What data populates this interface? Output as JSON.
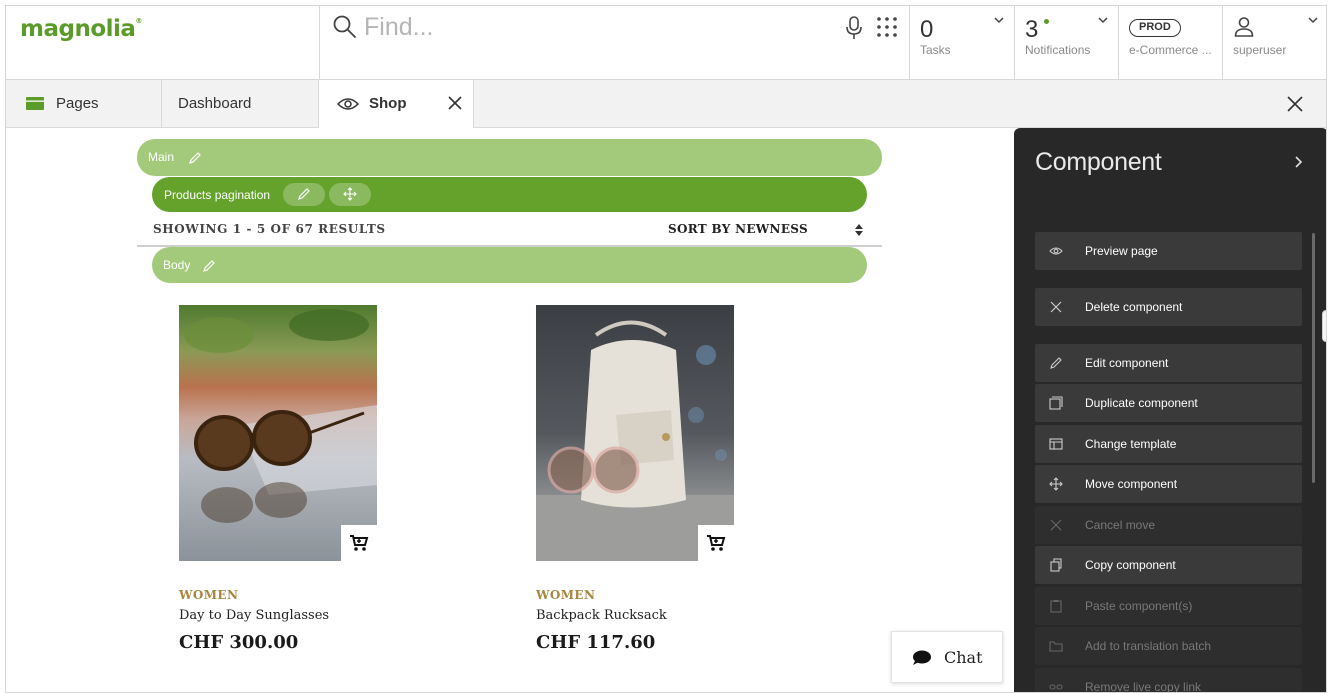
{
  "header": {
    "logo": "magnolia",
    "search": {
      "placeholder": "Find..."
    },
    "tasks": {
      "count": "0",
      "label": "Tasks"
    },
    "notifications": {
      "count": "3",
      "label": "Notifications"
    },
    "environment": {
      "badge": "PROD",
      "label": "e-Commerce ..."
    },
    "user": {
      "name": "superuser"
    }
  },
  "tabs": {
    "items": [
      {
        "label": "Pages"
      },
      {
        "label": "Dashboard"
      },
      {
        "label": "Shop"
      }
    ]
  },
  "editor": {
    "main_bar": "Main",
    "pagination_bar": "Products pagination",
    "body_bar": "Body",
    "results": "SHOWING 1 - 5 OF 67 RESULTS",
    "sort": "SORT BY NEWNESS",
    "products": [
      {
        "category": "WOMEN",
        "name": "Day to Day Sunglasses",
        "price": "CHF 300.00"
      },
      {
        "category": "WOMEN",
        "name": "Backpack Rucksack",
        "price": "CHF 117.60"
      }
    ],
    "chat": "Chat"
  },
  "panel": {
    "title": "Component",
    "actions": [
      {
        "label": "Preview page",
        "icon": "eye-icon",
        "enabled": true
      },
      {
        "label": "Delete component",
        "icon": "close-icon",
        "enabled": true
      },
      {
        "label": "Edit component",
        "icon": "pencil-icon",
        "enabled": true
      },
      {
        "label": "Duplicate component",
        "icon": "duplicate-icon",
        "enabled": true
      },
      {
        "label": "Change template",
        "icon": "template-icon",
        "enabled": true
      },
      {
        "label": "Move component",
        "icon": "move-icon",
        "enabled": true
      },
      {
        "label": "Cancel move",
        "icon": "close-icon",
        "enabled": false
      },
      {
        "label": "Copy component",
        "icon": "copy-icon",
        "enabled": true
      },
      {
        "label": "Paste component(s)",
        "icon": "clipboard-icon",
        "enabled": false
      },
      {
        "label": "Add to translation batch",
        "icon": "folder-icon",
        "enabled": false
      },
      {
        "label": "Remove live copy link",
        "icon": "unlink-icon",
        "enabled": false
      }
    ]
  },
  "colors": {
    "brand_green": "#5b9b2a",
    "bar_light": "#a3c97b",
    "bar_dark": "#64a22b",
    "category_gold": "#a8863e",
    "panel_bg": "#282828"
  }
}
